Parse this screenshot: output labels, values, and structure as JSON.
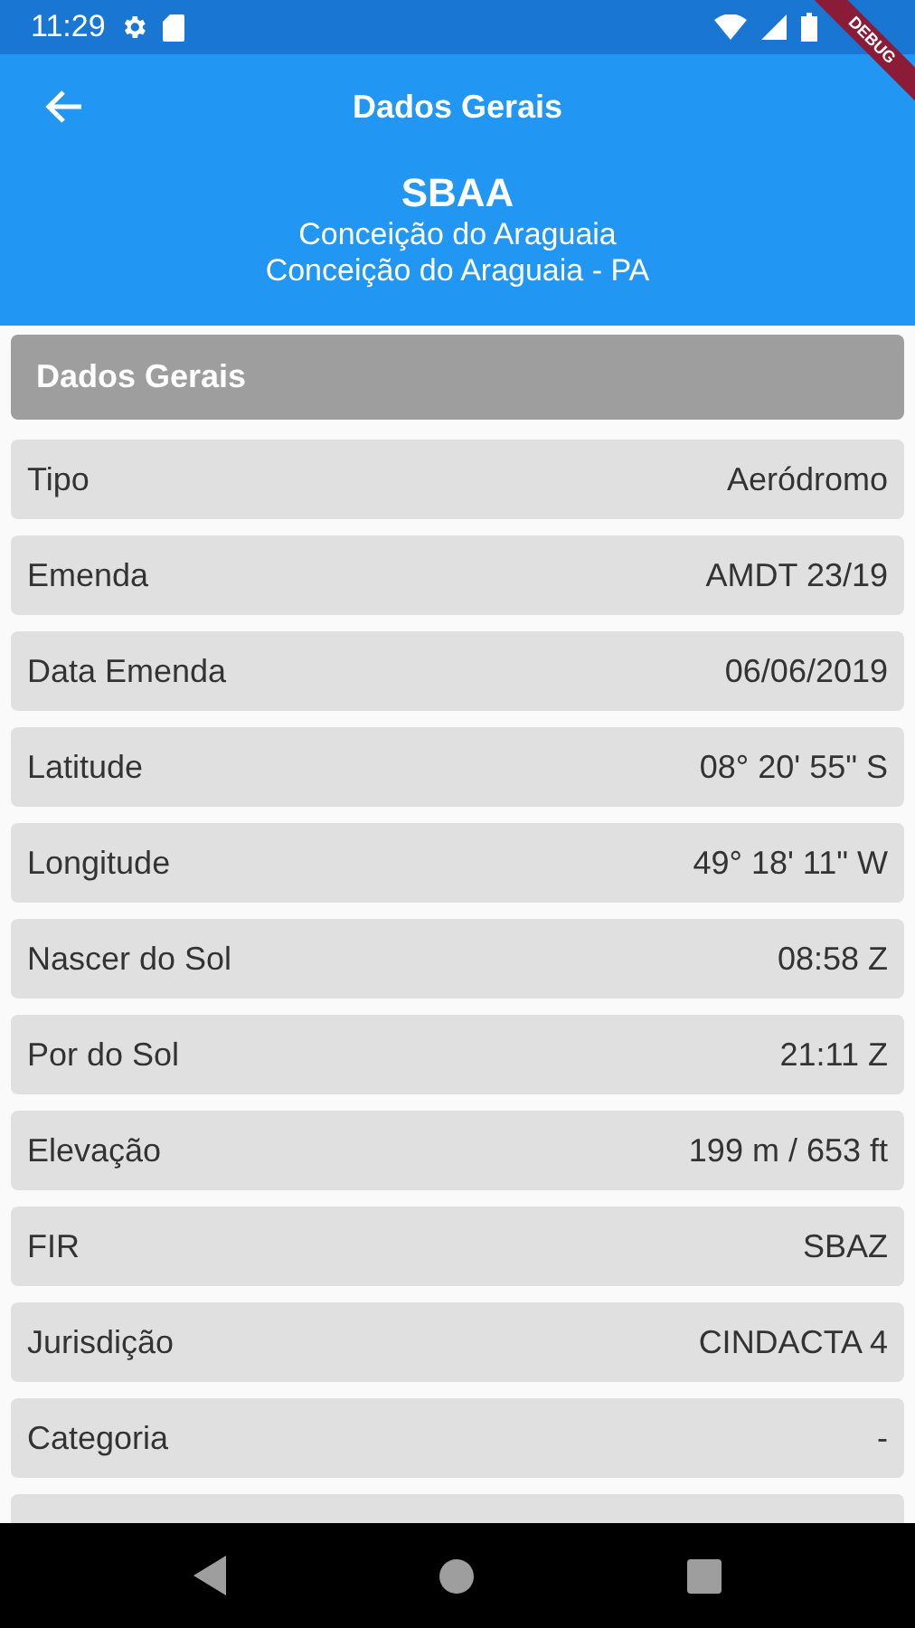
{
  "status_bar": {
    "time": "11:29"
  },
  "debug_banner": {
    "label": "DEBUG"
  },
  "app_bar": {
    "title": "Dados Gerais",
    "code": "SBAA",
    "name": "Conceição do Araguaia",
    "location": "Conceição do Araguaia - PA"
  },
  "section": {
    "title": "Dados Gerais"
  },
  "rows": [
    {
      "label": "Tipo",
      "value": "Aeródromo"
    },
    {
      "label": "Emenda",
      "value": "AMDT 23/19"
    },
    {
      "label": "Data Emenda",
      "value": "06/06/2019"
    },
    {
      "label": "Latitude",
      "value": "08° 20' 55\" S"
    },
    {
      "label": "Longitude",
      "value": "49° 18' 11\" W"
    },
    {
      "label": "Nascer do Sol",
      "value": "08:58 Z"
    },
    {
      "label": "Por do Sol",
      "value": "21:11 Z"
    },
    {
      "label": "Elevação",
      "value": "199 m / 653 ft"
    },
    {
      "label": "FIR",
      "value": "SBAZ"
    },
    {
      "label": "Jurisdição",
      "value": "CINDACTA 4"
    },
    {
      "label": "Categoria",
      "value": "-"
    }
  ]
}
